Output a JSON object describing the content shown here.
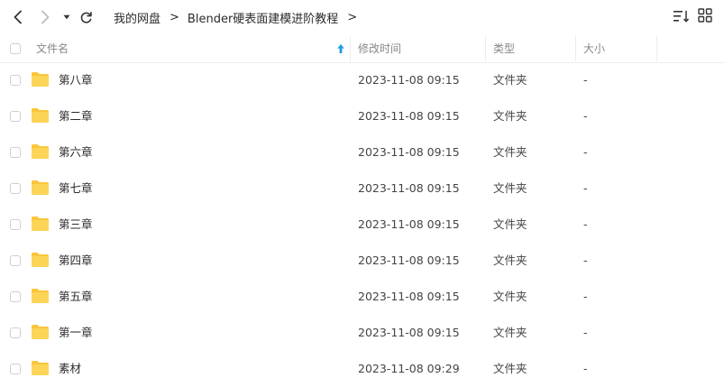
{
  "icons": {
    "back": "chevron-left-icon",
    "forward": "chevron-right-icon",
    "dropdown": "caret-down-icon",
    "refresh": "refresh-icon",
    "sort": "sort-list-icon",
    "grid": "grid-view-icon",
    "folder": "folder-icon"
  },
  "colors": {
    "folder": "#F9C53B",
    "accent": "#1E9BE8"
  },
  "breadcrumb": {
    "items": [
      "我的网盘",
      "Blender硬表面建模进阶教程"
    ],
    "separator": ">"
  },
  "columns": {
    "name": "文件名",
    "modified": "修改时间",
    "type": "类型",
    "size": "大小"
  },
  "files": [
    {
      "name": "第八章",
      "modified": "2023-11-08 09:15",
      "type": "文件夹",
      "size": "-"
    },
    {
      "name": "第二章",
      "modified": "2023-11-08 09:15",
      "type": "文件夹",
      "size": "-"
    },
    {
      "name": "第六章",
      "modified": "2023-11-08 09:15",
      "type": "文件夹",
      "size": "-"
    },
    {
      "name": "第七章",
      "modified": "2023-11-08 09:15",
      "type": "文件夹",
      "size": "-"
    },
    {
      "name": "第三章",
      "modified": "2023-11-08 09:15",
      "type": "文件夹",
      "size": "-"
    },
    {
      "name": "第四章",
      "modified": "2023-11-08 09:15",
      "type": "文件夹",
      "size": "-"
    },
    {
      "name": "第五章",
      "modified": "2023-11-08 09:15",
      "type": "文件夹",
      "size": "-"
    },
    {
      "name": "第一章",
      "modified": "2023-11-08 09:15",
      "type": "文件夹",
      "size": "-"
    },
    {
      "name": "素材",
      "modified": "2023-11-08 09:29",
      "type": "文件夹",
      "size": "-"
    }
  ]
}
